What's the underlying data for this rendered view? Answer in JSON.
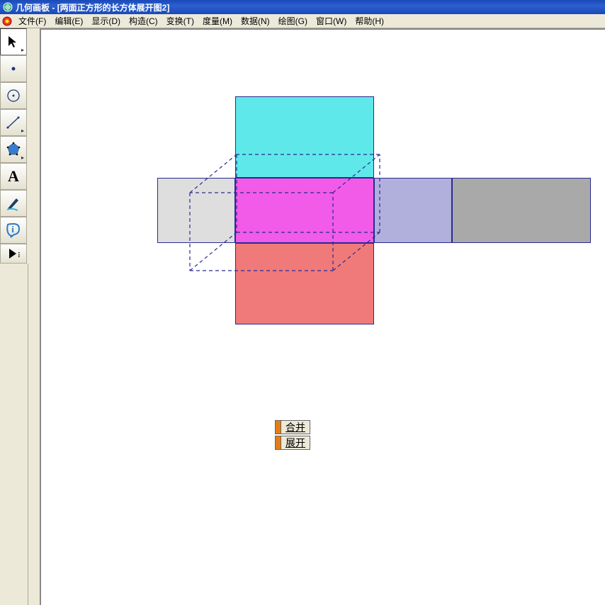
{
  "window": {
    "app_name": "几何画板",
    "separator": " - ",
    "doc_title": "[两面正方形的长方体展开图2]"
  },
  "menu": {
    "file": "文件(F)",
    "edit": "编辑(E)",
    "display": "显示(D)",
    "construct": "构造(C)",
    "transform": "变换(T)",
    "measure": "度量(M)",
    "number": "数据(N)",
    "graph": "绘图(G)",
    "window": "窗口(W)",
    "help": "帮助(H)"
  },
  "tools": {
    "arrow": "selection-arrow",
    "point": "point-tool",
    "circle": "compass-tool",
    "line": "straightedge-tool",
    "polygon": "polygon-tool",
    "text": "text-tool",
    "marker": "marker-tool",
    "info": "information-tool",
    "custom": "custom-tool"
  },
  "actions": {
    "merge": "合并",
    "unfold": "展开"
  },
  "colors": {
    "top": "#5fe8ea",
    "front": "#f15be8",
    "bottom": "#f07a7a",
    "right": "#b1b0dc",
    "far_right": "#a9a9a9",
    "left": "#dedede"
  }
}
